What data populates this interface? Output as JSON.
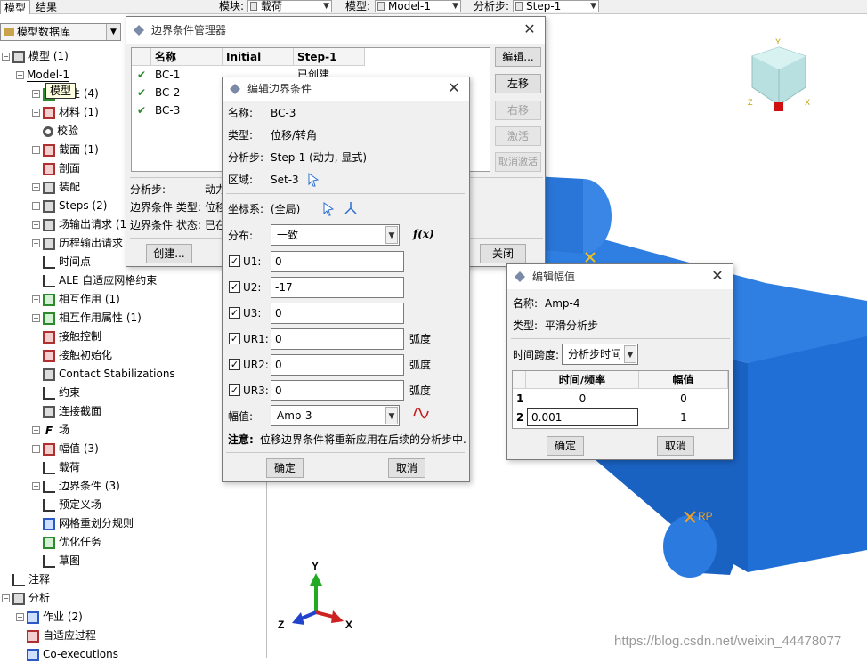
{
  "top": {
    "tabs": [
      "模型",
      "结果"
    ],
    "module_label": "模块:",
    "module_value": "载荷",
    "model_label": "模型:",
    "model_value": "Model-1",
    "step_label": "分析步:",
    "step_value": "Step-1"
  },
  "tree": {
    "db_combo": "模型数据库",
    "tooltip": "模型",
    "items": [
      "模型 (1)",
      "Model-1",
      "属性 (4)",
      "材料 (1)",
      "校验",
      "截面 (1)",
      "剖面",
      "装配",
      "Steps (2)",
      "场输出请求 (1)",
      "历程输出请求",
      "时间点",
      "ALE 自适应网格约束",
      "相互作用 (1)",
      "相互作用属性 (1)",
      "接触控制",
      "接触初始化",
      "Contact Stabilizations",
      "约束",
      "连接截面",
      "场",
      "幅值 (3)",
      "载荷",
      "边界条件 (3)",
      "预定义场",
      "网格重划分规则",
      "优化任务",
      "草图",
      "注释",
      "分析",
      "作业 (2)",
      "自适应过程",
      "Co-executions"
    ]
  },
  "bc_manager": {
    "title": "边界条件管理器",
    "col_name": "名称",
    "col_initial": "Initial",
    "col_step": "Step-1",
    "rows": [
      {
        "name": "BC-1",
        "step": "已创建"
      },
      {
        "name": "BC-2",
        "step": ""
      },
      {
        "name": "BC-3",
        "step": ""
      }
    ],
    "btn_edit": "编辑...",
    "btn_left": "左移",
    "btn_right": "右移",
    "btn_activate": "激活",
    "btn_deactivate": "取消激活",
    "info_step": "分析步:",
    "info_step_val": "动力",
    "info_type": "边界条件 类型:",
    "info_type_val": "位移",
    "info_status": "边界条件 状态:",
    "info_status_val": "已在",
    "btn_create": "创建...",
    "btn_close": "关闭"
  },
  "edit_bc": {
    "title": "编辑边界条件",
    "name_label": "名称:",
    "name_value": "BC-3",
    "type_label": "类型:",
    "type_value": "位移/转角",
    "step_label": "分析步:",
    "step_value": "Step-1 (动力, 显式)",
    "region_label": "区域:",
    "region_value": "Set-3",
    "csys_label": "坐标系:",
    "csys_value": "(全局)",
    "dist_label": "分布:",
    "dist_value": "一致",
    "fx": "f(x)",
    "dofs": [
      {
        "label": "U1:",
        "value": "0",
        "unit": ""
      },
      {
        "label": "U2:",
        "value": "-17",
        "unit": ""
      },
      {
        "label": "U3:",
        "value": "0",
        "unit": ""
      },
      {
        "label": "UR1:",
        "value": "0",
        "unit": "弧度"
      },
      {
        "label": "UR2:",
        "value": "0",
        "unit": "弧度"
      },
      {
        "label": "UR3:",
        "value": "0",
        "unit": "弧度"
      }
    ],
    "amp_label": "幅值:",
    "amp_value": "Amp-3",
    "note_bold": "注意:",
    "note_text": "位移边界条件将重新应用在后续的分析步中.",
    "btn_ok": "确定",
    "btn_cancel": "取消"
  },
  "edit_amp": {
    "title": "编辑幅值",
    "name_label": "名称:",
    "name_value": "Amp-4",
    "type_label": "类型:",
    "type_value": "平滑分析步",
    "span_label": "时间跨度:",
    "span_value": "分析步时间",
    "col_time": "时间/频率",
    "col_amp": "幅值",
    "rows": [
      {
        "idx": "1",
        "time": "0",
        "amp": "0"
      },
      {
        "idx": "2",
        "time": "0.001",
        "amp": "1"
      }
    ],
    "btn_ok": "确定",
    "btn_cancel": "取消"
  },
  "viewport": {
    "rp_label": "RP",
    "axis_y": "Y",
    "axis_x": "X",
    "axis_z": "Z",
    "watermark": "https://blog.csdn.net/weixin_44478077"
  },
  "colors": {
    "part_blue": "#1f6fd6",
    "part_dark": "#1556ad",
    "part_light": "#3f8ae8",
    "check_green": "#2a8a2a"
  }
}
